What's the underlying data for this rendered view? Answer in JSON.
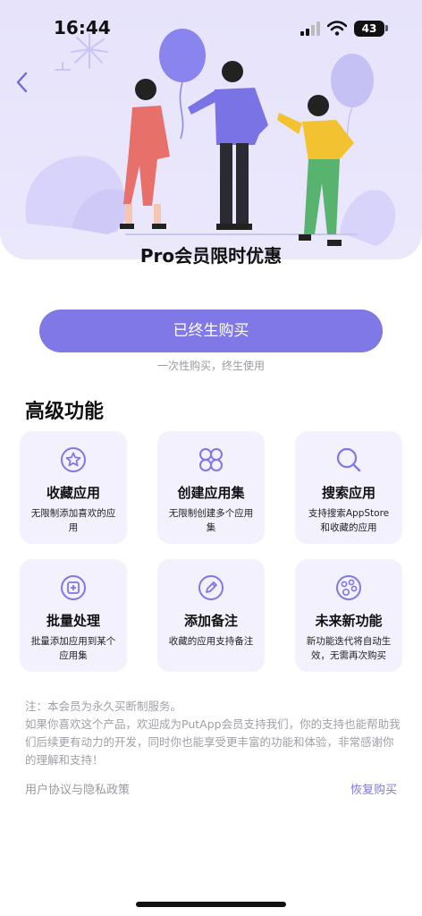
{
  "status_bar": {
    "time": "16:44",
    "battery": "43"
  },
  "promo_title": "Pro会员限时优惠",
  "buy_button": {
    "label": "已终生购买"
  },
  "buy_subtitle": "一次性购买，终生使用",
  "features": {
    "title": "高级功能",
    "items": [
      {
        "icon": "star-circle-icon",
        "title": "收藏应用",
        "desc": "无限制添加喜欢的应用"
      },
      {
        "icon": "grid-circles-icon",
        "title": "创建应用集",
        "desc": "无限制创建多个应用集"
      },
      {
        "icon": "search-icon",
        "title": "搜索应用",
        "desc": "支持搜索AppStore和收藏的应用"
      },
      {
        "icon": "batch-add-icon",
        "title": "批量处理",
        "desc": "批量添加应用到某个应用集"
      },
      {
        "icon": "pencil-icon",
        "title": "添加备注",
        "desc": "收藏的应用支持备注"
      },
      {
        "icon": "palette-icon",
        "title": "未来新功能",
        "desc": "新功能迭代将自动生效，无需再次购买"
      }
    ]
  },
  "note": "注：本会员为永久买断制服务。\n如果你喜欢这个产品，欢迎成为PutApp会员支持我们，你的支持也能帮助我们后续更有动力的开发，同时你也能享受更丰富的功能和体验，非常感谢你的理解和支持！",
  "footer": {
    "policy_link": "用户协议与隐私政策",
    "restore_link": "恢复购买"
  },
  "colors": {
    "accent": "#7f78e6",
    "hero_bg": "#e6e3fb",
    "card_bg": "#f2f1fd"
  }
}
